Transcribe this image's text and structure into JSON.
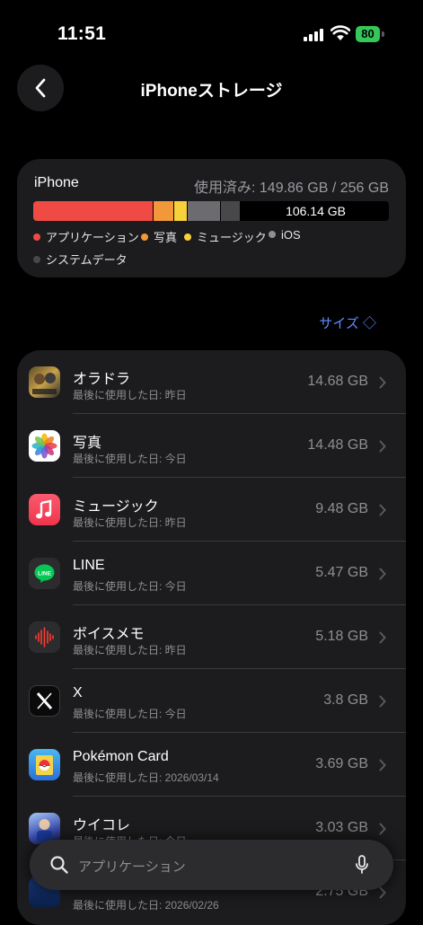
{
  "status_bar": {
    "time": "11:51",
    "battery": "80"
  },
  "header": {
    "title": "iPhoneストレージ"
  },
  "storage": {
    "device": "iPhone",
    "used": "使用済み: 149.86 GB / 256 GB",
    "free": "106.14 GB",
    "legend": [
      {
        "label": "アプリケーション",
        "color": "#f04a44"
      },
      {
        "label": "写真",
        "color": "#f2973a"
      },
      {
        "label": "ミュージック",
        "color": "#f7d13c"
      },
      {
        "label": "iOS",
        "color": "#8e8e93"
      },
      {
        "label": "システムデータ",
        "color": "#48484a"
      }
    ]
  },
  "sort": {
    "label": "サイズ ◇"
  },
  "apps": [
    {
      "name": "オラドラ",
      "last_used": "最後に使用した日: 昨日",
      "size": "14.68 GB",
      "icon": "oradora-icon"
    },
    {
      "name": "写真",
      "last_used": "最後に使用した日: 今日",
      "size": "14.48 GB",
      "icon": "photos-icon"
    },
    {
      "name": "ミュージック",
      "last_used": "最後に使用した日: 昨日",
      "size": "9.48 GB",
      "icon": "music-icon"
    },
    {
      "name": "LINE",
      "last_used": "最後に使用した日: 今日",
      "size": "5.47 GB",
      "icon": "line-icon"
    },
    {
      "name": "ボイスメモ",
      "last_used": "最後に使用した日: 昨日",
      "size": "5.18 GB",
      "icon": "voice-memo-icon"
    },
    {
      "name": "X",
      "last_used": "最後に使用した日: 今日",
      "size": "3.8 GB",
      "icon": "x-icon"
    },
    {
      "name": "Pokémon Card",
      "last_used": "最後に使用した日: 2026/03/14",
      "size": "3.69 GB",
      "icon": "pokemon-card-icon"
    },
    {
      "name": "ウイコレ",
      "last_used": "最後に使用した日: 今日",
      "size": "3.03 GB",
      "icon": "uicolle-icon"
    },
    {
      "name": "",
      "last_used": "最後に使用した日: 2026/02/26",
      "size": "2.75 GB",
      "icon": "app-icon"
    }
  ],
  "search": {
    "placeholder": "アプリケーション"
  }
}
